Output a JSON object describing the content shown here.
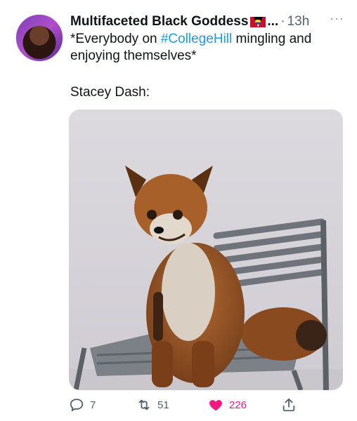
{
  "tweet": {
    "author_name": "Multifaceted Black Goddess",
    "ellipsis": "...",
    "separator": "·",
    "time": "13h",
    "more_label": "···",
    "text_before": "*Everybody on ",
    "hashtag": "#CollegeHill",
    "text_after": " mingling and enjoying themselves*",
    "second_line": "Stacey Dash:"
  },
  "actions": {
    "replies": "7",
    "retweets": "51",
    "likes": "226"
  },
  "colors": {
    "accent": "#1d9bf0",
    "like": "#f91880",
    "muted": "#536471"
  },
  "icons": [
    "reply-icon",
    "retweet-icon",
    "heart-icon",
    "share-icon",
    "more-icon"
  ]
}
